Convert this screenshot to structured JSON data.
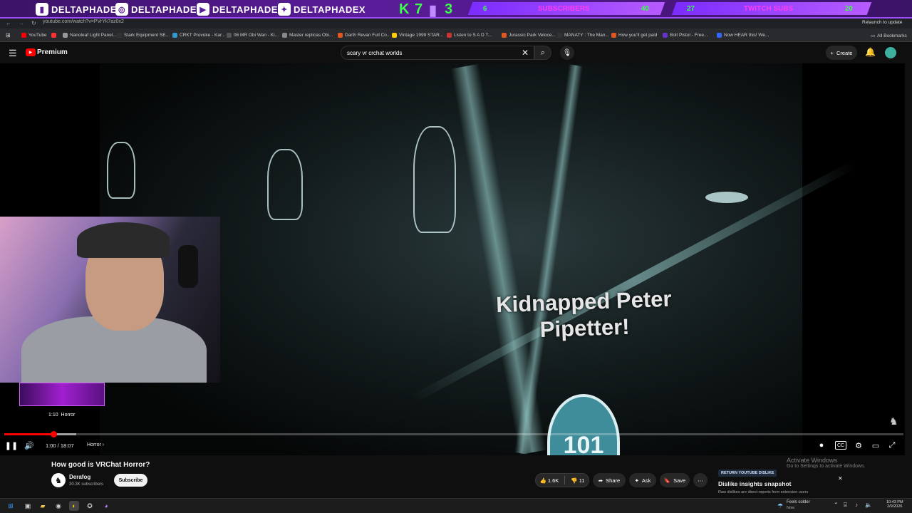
{
  "overlay": {
    "socials": [
      "DELTAPHADE",
      "DELTAPHADE",
      "DELTAPHADE",
      "DELTAPHADEX"
    ],
    "k_value": "7",
    "twitch_value": "3",
    "subscribers": {
      "left": "6",
      "label": "SUBSCRIBERS",
      "right": "40"
    },
    "twitch_subs": {
      "left": "27",
      "label": "TWITCH SUBS",
      "right": "20"
    },
    "relaunch": "Relaunch to update"
  },
  "browser": {
    "url": "youtube.com/watch?v=PVrYk7az0x2",
    "bookmarks": [
      "YouTube",
      "Nanoleaf Light Panel...",
      "Stark Equipment SE...",
      "CRKT Provoke - Kar...",
      "06 MR Obi Wan - Ki...",
      "Master replicas Obi...",
      "Darth Revan Full Co...",
      "Vintage 1999 STAR...",
      "Listen to S A D T...",
      "Jurassic Park Veloce...",
      "MANATY : The Man...",
      "How you'll get paid",
      "Bolt Pistol - Free...",
      "Now HEAR this! We..."
    ],
    "all_bookmarks": "All Bookmarks"
  },
  "youtube": {
    "logo": "Premium",
    "search_value": "scary vr crchat worlds",
    "create": "Create"
  },
  "video": {
    "caption_line1": "Kidnapped Peter",
    "caption_line2": "Pipetter!",
    "shield_number": "101",
    "chapter_preview_time": "1:10",
    "chapter_preview_label": "Horror",
    "time": "1:00 / 18:07",
    "chapter": "Horror",
    "progress_fraction": 0.055
  },
  "info": {
    "title": "How good is VRChat Horror?",
    "channel": "Derafog",
    "subscribers": "30.3K subscribers",
    "subscribe": "Subscribe",
    "likes": "1.6K",
    "dislikes": "11",
    "share": "Share",
    "ask": "Ask",
    "save": "Save"
  },
  "popup": {
    "badge": "RETURN YOUTUBE DISLIKE",
    "title": "Dislike insights snapshot",
    "body": "Raw dislikes are direct reports from extension users"
  },
  "watermark": {
    "line1": "Activate Windows",
    "line2": "Go to Settings to activate Windows."
  },
  "taskbar": {
    "weather_title": "Feels colder",
    "weather_sub": "Now",
    "time": "10:43 PM",
    "date": "2/9/2026"
  },
  "colors": {
    "accent": "#ff0000",
    "overlay_purple": "#5b1c9a",
    "overlay_green": "#39ff4a"
  }
}
